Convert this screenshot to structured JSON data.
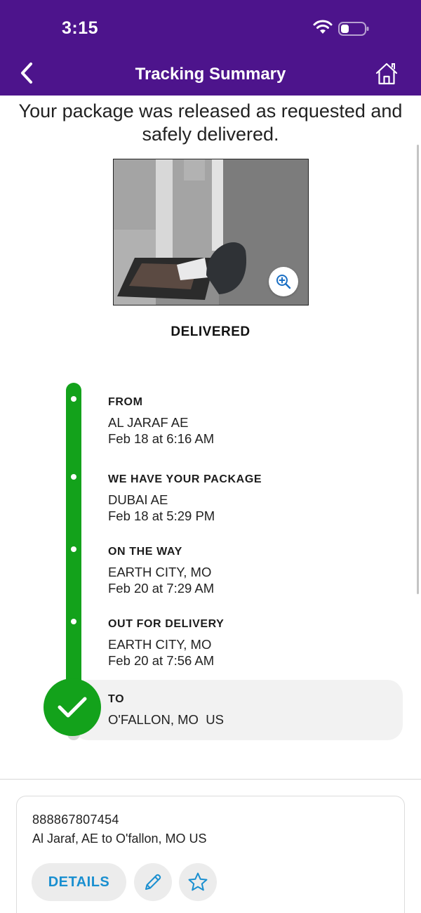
{
  "status_bar": {
    "time": "3:15"
  },
  "header": {
    "title": "Tracking Summary"
  },
  "message": "Your package was released as requested and safely delivered.",
  "delivery_status": "DELIVERED",
  "timeline": [
    {
      "title": "FROM",
      "location": "AL JARAF AE",
      "datetime": "Feb 18 at 6:16 AM"
    },
    {
      "title": "WE HAVE YOUR PACKAGE",
      "location": "DUBAI AE",
      "datetime": "Feb 18 at 5:29 PM"
    },
    {
      "title": "ON THE WAY",
      "location": "EARTH CITY, MO",
      "datetime": "Feb 20 at 7:29 AM"
    },
    {
      "title": "OUT FOR DELIVERY",
      "location": "EARTH CITY, MO",
      "datetime": "Feb 20 at 7:56 AM"
    },
    {
      "title": "TO",
      "location": "O'FALLON, MO  US"
    }
  ],
  "shipment_card": {
    "tracking_number": "888867807454",
    "route": "Al Jaraf, AE to O'fallon, MO US",
    "details_label": "DETAILS"
  },
  "colors": {
    "header_purple": "#4d148c",
    "timeline_green": "#13a21b",
    "link_blue": "#1a8fd0"
  },
  "icons": [
    "back-chevron-icon",
    "home-icon",
    "wifi-icon",
    "battery-icon",
    "zoom-in-icon",
    "checkmark-icon",
    "pencil-icon",
    "star-icon"
  ]
}
